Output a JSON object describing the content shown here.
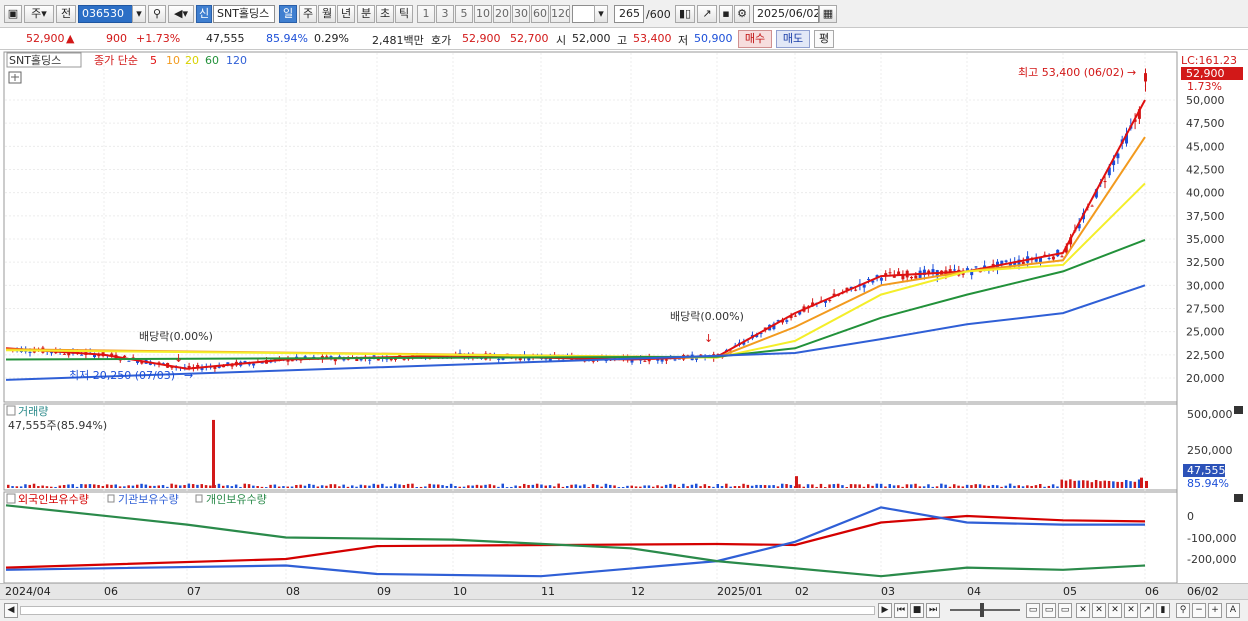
{
  "toolbar": {
    "market": "주",
    "prev": "전",
    "code": "036530",
    "stock_tag": "신",
    "stock_name": "SNT홀딩스",
    "periods": [
      "일",
      "주",
      "월",
      "년",
      "분",
      "초",
      "틱"
    ],
    "intervals": [
      "1",
      "3",
      "5",
      "10",
      "20",
      "30",
      "60",
      "120"
    ],
    "count": "265",
    "total": "/600",
    "date": "2025/06/02"
  },
  "quote": {
    "price": "52,900",
    "change": "900",
    "change_pct": "+1.73%",
    "volume": "47,555",
    "vol_ratio": "85.94%",
    "turnover": "0.29%",
    "amount": "2,481백만",
    "hoga_label": "호가",
    "bid": "52,900",
    "ask": "52,700",
    "open_label": "시",
    "open": "52,000",
    "high_label": "고",
    "high": "53,400",
    "low_label": "저",
    "low": "50,900",
    "buy_btn": "매수",
    "sell_btn": "매도",
    "avg_btn": "평"
  },
  "legend": {
    "stock": "SNT홀딩스",
    "price_label": "종가 단순",
    "ma": [
      "5",
      "10",
      "20",
      "60",
      "120"
    ]
  },
  "annotations": {
    "high": "최고 53,400 (06/02)",
    "low": "최저 20,250 (07/03)",
    "div1": "배당락(0.00%)",
    "div2": "배당락(0.00%)"
  },
  "price_axis": {
    "lc": "LC:161.23",
    "last_price": "52,900",
    "last_pct": "1.73%",
    "ticks": [
      "50,000",
      "47,500",
      "45,000",
      "42,500",
      "40,000",
      "37,500",
      "35,000",
      "32,500",
      "30,000",
      "27,500",
      "25,000",
      "22,500",
      "20,000"
    ]
  },
  "volume_panel": {
    "title": "거래량",
    "current": "47,555주(85.94%)",
    "ticks": [
      "500,000",
      "250,000"
    ],
    "last": "47,555",
    "last_pct": "85.94%"
  },
  "holdings_panel": {
    "foreign": "외국인보유수량",
    "institution": "기관보유수량",
    "individual": "개인보유수량",
    "ticks": [
      "0",
      "-100,000",
      "-200,000"
    ]
  },
  "dates": [
    "2024/04",
    "06",
    "07",
    "08",
    "09",
    "10",
    "11",
    "12",
    "2025/01",
    "02",
    "03",
    "04",
    "05",
    "06"
  ],
  "date_right": "06/02",
  "colors": {
    "up": "#d21818",
    "down": "#1c4fd8",
    "ma5": "#e01010",
    "ma10": "#f29a1e",
    "ma20": "#f4ee2a",
    "ma60": "#22913a",
    "ma120": "#2f5fd6",
    "foreign": "#d40000",
    "institution": "#2f5fd6",
    "individual": "#2a8a4a"
  },
  "chart_data": [
    {
      "type": "candlestick",
      "title": "SNT홀딩스 일봉",
      "series": [
        {
          "name": "5",
          "x": [
            "2024/04",
            "2024/06",
            "2024/07",
            "2024/08",
            "2024/10",
            "2024/12",
            "2025/01",
            "2025/02",
            "2025/03",
            "2025/04",
            "2025/05",
            "2025/06/02"
          ],
          "values": [
            23200,
            22500,
            21000,
            22000,
            22400,
            22000,
            22300,
            27000,
            31000,
            31500,
            33500,
            50000
          ]
        },
        {
          "name": "10",
          "x": [
            "2024/04",
            "2025/01",
            "2025/02",
            "2025/03",
            "2025/04",
            "2025/05",
            "2025/06/02"
          ],
          "values": [
            23100,
            22200,
            25500,
            30000,
            31500,
            32700,
            46000
          ]
        },
        {
          "name": "20",
          "x": [
            "2024/04",
            "2025/01",
            "2025/02",
            "2025/03",
            "2025/04",
            "2025/05",
            "2025/06/02"
          ],
          "values": [
            23000,
            22200,
            24000,
            29000,
            31500,
            32200,
            41000
          ]
        },
        {
          "name": "60",
          "x": [
            "2024/04",
            "2025/01",
            "2025/02",
            "2025/03",
            "2025/04",
            "2025/05",
            "2025/06/02"
          ],
          "values": [
            22000,
            22300,
            23200,
            26500,
            29000,
            31500,
            34900
          ]
        },
        {
          "name": "120",
          "x": [
            "2024/04",
            "2025/01",
            "2025/02",
            "2025/03",
            "2025/04",
            "2025/05",
            "2025/06/02"
          ],
          "values": [
            19800,
            22400,
            22700,
            24200,
            25800,
            27000,
            30000
          ]
        }
      ],
      "last": {
        "date": "2025/06/02",
        "open": 52000,
        "high": 53400,
        "low": 50900,
        "close": 52900
      },
      "ylim": [
        19000,
        54000
      ]
    },
    {
      "type": "bar",
      "title": "거래량",
      "series": [
        {
          "name": "거래량",
          "x": [
            "2024/07",
            "2025/02",
            "2025/05/30",
            "2025/06/02"
          ],
          "values": [
            460000,
            80000,
            70000,
            47555
          ]
        }
      ],
      "ylim": [
        0,
        500000
      ]
    },
    {
      "type": "line",
      "series": [
        {
          "name": "외국인보유수량",
          "x": [
            "2024/04",
            "2024/08",
            "2024/09",
            "2025/01",
            "2025/02",
            "2025/03",
            "2025/04",
            "2025/05",
            "2025/06/02"
          ],
          "values": [
            -240000,
            -200000,
            -140000,
            -130000,
            -135000,
            -30000,
            0,
            -20000,
            -25000
          ]
        },
        {
          "name": "기관보유수량",
          "x": [
            "2024/04",
            "2024/08",
            "2024/09",
            "2024/11",
            "2025/01",
            "2025/02",
            "2025/03",
            "2025/04",
            "2025/05",
            "2025/06/02"
          ],
          "values": [
            -250000,
            -230000,
            -270000,
            -280000,
            -210000,
            -120000,
            40000,
            -30000,
            -40000,
            -40000
          ]
        },
        {
          "name": "개인보유수량",
          "x": [
            "2024/04",
            "2024/07",
            "2024/08",
            "2024/10",
            "2024/12",
            "2025/01",
            "2025/03",
            "2025/04",
            "2025/05",
            "2025/06/02"
          ],
          "values": [
            50000,
            -40000,
            -100000,
            -110000,
            -150000,
            -210000,
            -280000,
            -240000,
            -250000,
            -230000
          ]
        }
      ],
      "ylim": [
        -280000,
        60000
      ]
    }
  ]
}
